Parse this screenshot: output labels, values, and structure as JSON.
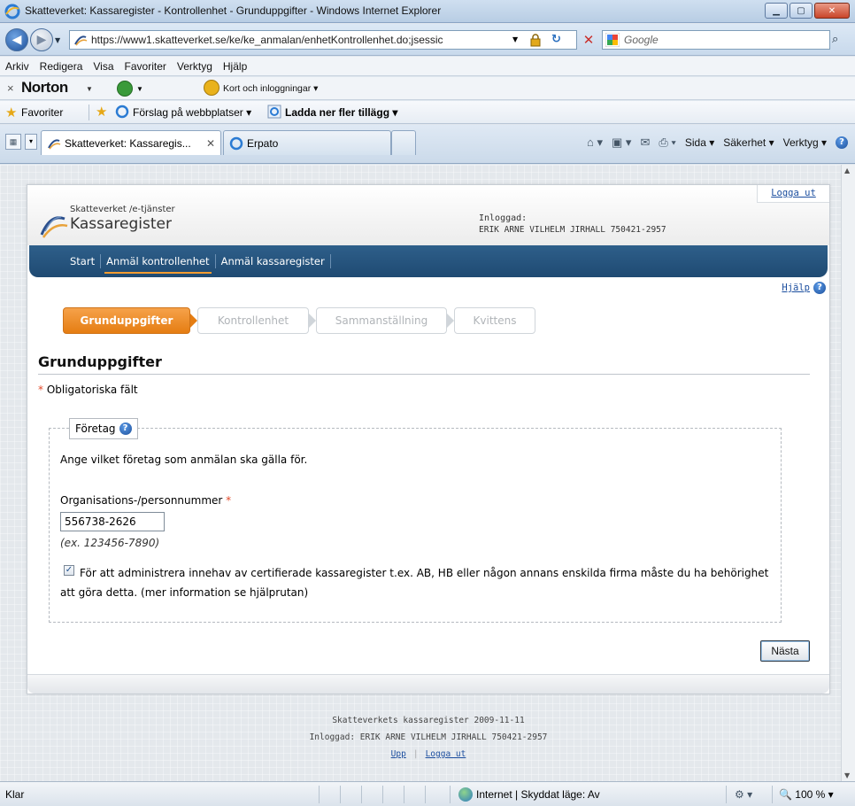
{
  "window": {
    "title": "Skatteverket: Kassaregister - Kontrollenhet - Grunduppgifter - Windows Internet Explorer"
  },
  "address": {
    "url": "https://www1.skatteverket.se/ke/ke_anmalan/enhetKontrollenhet.do;jsessic",
    "search_placeholder": "Google"
  },
  "menu": [
    "Arkiv",
    "Redigera",
    "Visa",
    "Favoriter",
    "Verktyg",
    "Hjälp"
  ],
  "norton": {
    "brand": "Norton",
    "cards": "Kort och inloggningar ▾"
  },
  "favorites_bar": {
    "label": "Favoriter",
    "suggestions": "Förslag på webbplatser ▾",
    "more_addons": "Ladda ner fler tillägg ▾"
  },
  "tabs": [
    {
      "label": "Skatteverket: Kassaregis...",
      "active": true
    },
    {
      "label": "Erpato",
      "active": false
    }
  ],
  "command_bar": {
    "page": "Sida ▾",
    "safety": "Säkerhet ▾",
    "tools": "Verktyg ▾"
  },
  "site": {
    "org": "Skatteverket /e-tjänster",
    "app": "Kassaregister",
    "logged_in_label": "Inloggad:",
    "logged_in_user": "ERIK ARNE VILHELM JIRHALL 750421-2957",
    "logout": "Logga ut",
    "help": "Hjälp",
    "nav": [
      {
        "label": "Start",
        "active": false
      },
      {
        "label": "Anmäl kontrollenhet",
        "active": true
      },
      {
        "label": "Anmäl kassaregister",
        "active": false
      }
    ]
  },
  "steps": [
    {
      "label": "Grunduppgifter",
      "active": true
    },
    {
      "label": "Kontrollenhet",
      "active": false
    },
    {
      "label": "Sammanställning",
      "active": false
    },
    {
      "label": "Kvittens",
      "active": false
    }
  ],
  "form": {
    "title": "Grunduppgifter",
    "required_star": "*",
    "required_note": "Obligatoriska fält",
    "fieldset_legend": "Företag",
    "description": "Ange vilket företag som anmälan ska gälla för.",
    "org_label": "Organisations-/personnummer",
    "org_value": "556738-2626",
    "org_hint": "(ex. 123456-7890)",
    "checkbox_checked": true,
    "checkbox_text": "För att administrera innehav av certifierade kassaregister t.ex. AB, HB eller någon annans enskilda firma måste du ha behörighet att göra detta. (mer information se hjälprutan)",
    "next_button": "Nästa"
  },
  "footer": {
    "line1": "Skatteverkets kassaregister 2009-11-11",
    "line2": "Inloggad: ERIK ARNE VILHELM JIRHALL 750421-2957",
    "up": "Upp",
    "logout": "Logga ut"
  },
  "status": {
    "ready": "Klar",
    "zone": "Internet | Skyddat läge: Av",
    "zoom": "100 %"
  }
}
